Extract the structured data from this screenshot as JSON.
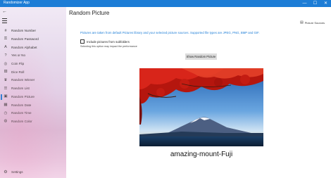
{
  "app": {
    "title": "Randomizer App"
  },
  "window_controls": {
    "minimize": "—",
    "maximize": "☐",
    "close": "✕"
  },
  "sidebar": {
    "back_glyph": "←",
    "items": [
      {
        "label": "Random Number",
        "icon": "hash-icon",
        "glyph": "#"
      },
      {
        "label": "Random Password",
        "icon": "key-icon",
        "glyph": "⚿"
      },
      {
        "label": "Random Alphabet",
        "icon": "alphabet-icon",
        "glyph": "A"
      },
      {
        "label": "Yes or No",
        "icon": "yes-no-icon",
        "glyph": "?"
      },
      {
        "label": "Coin Flip",
        "icon": "coin-icon",
        "glyph": "◎"
      },
      {
        "label": "Dice Roll",
        "icon": "dice-icon",
        "glyph": "⚄"
      },
      {
        "label": "Random Winner",
        "icon": "trophy-icon",
        "glyph": "♛"
      },
      {
        "label": "Random List",
        "icon": "list-icon",
        "glyph": "☰"
      },
      {
        "label": "Random Picture",
        "icon": "picture-icon",
        "glyph": "▣"
      },
      {
        "label": "Random Date",
        "icon": "calendar-icon",
        "glyph": "▦"
      },
      {
        "label": "Random Time",
        "icon": "clock-icon",
        "glyph": "◷"
      },
      {
        "label": "Random Color",
        "icon": "palette-icon",
        "glyph": "◍"
      }
    ],
    "active_index": 8,
    "settings": {
      "label": "Settings",
      "icon": "gear-icon",
      "glyph": "⚙"
    }
  },
  "main": {
    "title": "Random Picture",
    "picture_sources": {
      "label": "Picture Sources",
      "icon": "picture-sources-icon",
      "glyph": "▤"
    },
    "info": "Pictures are taken from default Pictures library and your selected picture sources. Supported file types are JPEG, PNG, BMP and GIF.",
    "include_subfolders": {
      "label": "Include pictures from subfolders",
      "checked": false
    },
    "hint": "Selecting this option may impact the performance",
    "show_button": "Show Random Picture",
    "picture_caption": "amazing-mount-Fuji"
  },
  "colors": {
    "accent": "#1d7dd6",
    "button_bg": "#dcdcdc"
  }
}
